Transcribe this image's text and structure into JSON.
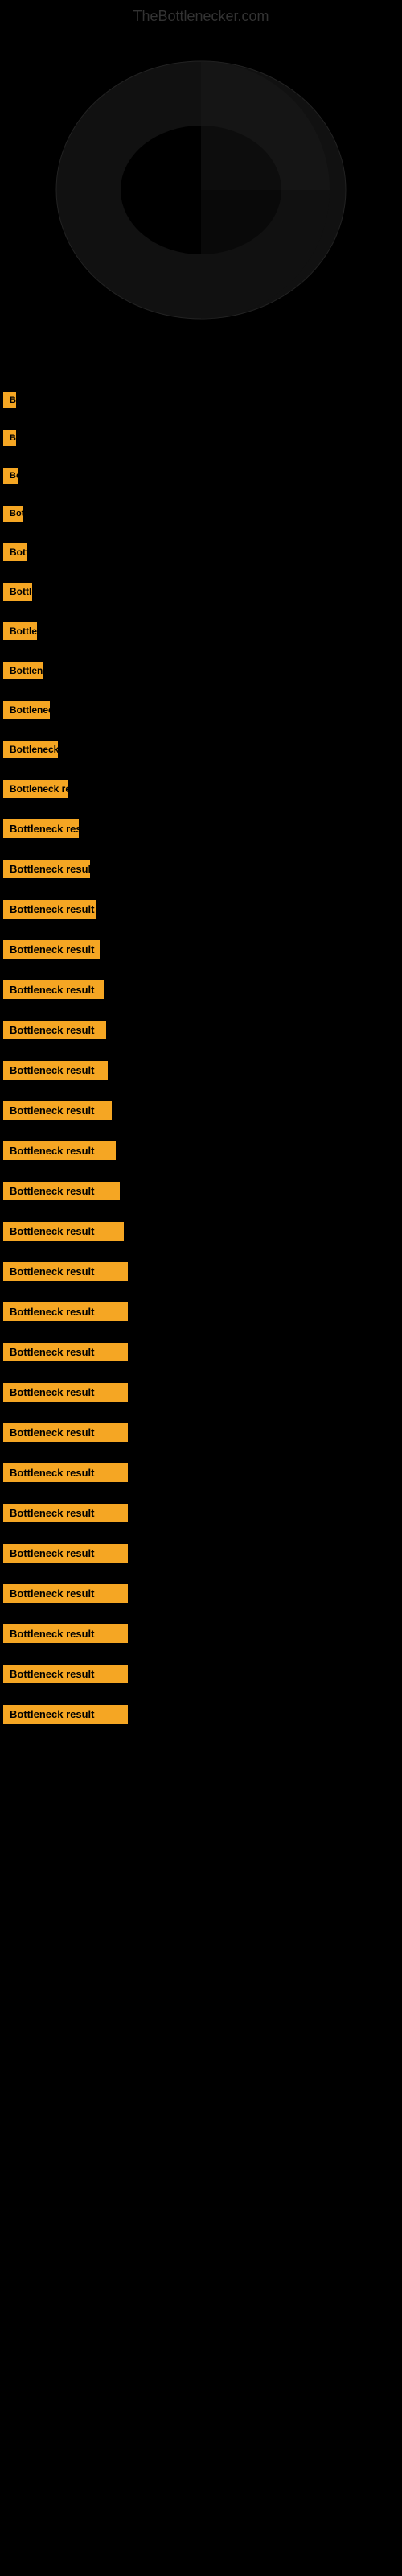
{
  "site": {
    "title": "TheBottlenecker.com"
  },
  "items": [
    {
      "label": "Bottleneck result",
      "index": 0
    },
    {
      "label": "Bottleneck result",
      "index": 1
    },
    {
      "label": "Bottleneck result",
      "index": 2
    },
    {
      "label": "Bottleneck result",
      "index": 3
    },
    {
      "label": "Bottleneck result",
      "index": 4
    },
    {
      "label": "Bottleneck result",
      "index": 5
    },
    {
      "label": "Bottleneck result",
      "index": 6
    },
    {
      "label": "Bottleneck result",
      "index": 7
    },
    {
      "label": "Bottleneck result",
      "index": 8
    },
    {
      "label": "Bottleneck result",
      "index": 9
    },
    {
      "label": "Bottleneck result",
      "index": 10
    },
    {
      "label": "Bottleneck result",
      "index": 11
    },
    {
      "label": "Bottleneck result",
      "index": 12
    },
    {
      "label": "Bottleneck result",
      "index": 13
    },
    {
      "label": "Bottleneck result",
      "index": 14
    },
    {
      "label": "Bottleneck result",
      "index": 15
    },
    {
      "label": "Bottleneck result",
      "index": 16
    },
    {
      "label": "Bottleneck result",
      "index": 17
    },
    {
      "label": "Bottleneck result",
      "index": 18
    },
    {
      "label": "Bottleneck result",
      "index": 19
    },
    {
      "label": "Bottleneck result",
      "index": 20
    },
    {
      "label": "Bottleneck result",
      "index": 21
    },
    {
      "label": "Bottleneck result",
      "index": 22
    },
    {
      "label": "Bottleneck result",
      "index": 23
    },
    {
      "label": "Bottleneck result",
      "index": 24
    },
    {
      "label": "Bottleneck result",
      "index": 25
    },
    {
      "label": "Bottleneck result",
      "index": 26
    },
    {
      "label": "Bottleneck result",
      "index": 27
    },
    {
      "label": "Bottleneck result",
      "index": 28
    },
    {
      "label": "Bottleneck result",
      "index": 29
    },
    {
      "label": "Bottleneck result",
      "index": 30
    },
    {
      "label": "Bottleneck result",
      "index": 31
    },
    {
      "label": "Bottleneck result",
      "index": 32
    },
    {
      "label": "Bottleneck result",
      "index": 33
    }
  ],
  "colors": {
    "background": "#000000",
    "badge": "#f5a623",
    "text": "#000000",
    "title": "#cccccc"
  }
}
